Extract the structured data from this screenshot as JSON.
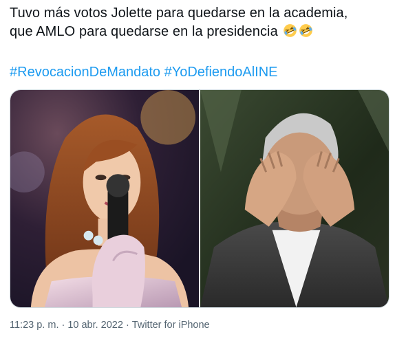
{
  "tweet": {
    "line1": "Tuvo más votos Jolette para quedarse en la academia,",
    "line2": "que AMLO para quedarse en la presidencia",
    "emoji_icon": "rolling-on-floor-laughing-emoji",
    "hashtags": [
      "#RevocacionDeMandato",
      "#YoDefiendoAlINE"
    ]
  },
  "media": {
    "photos": [
      {
        "icon": "photo-woman-singing-microphone"
      },
      {
        "icon": "photo-man-covering-eyes"
      }
    ]
  },
  "meta": {
    "time": "11:23 p. m.",
    "separator": "·",
    "date": "10 abr. 2022",
    "source": "Twitter for iPhone"
  },
  "colors": {
    "text": "#0f1419",
    "link": "#1d9bf0",
    "meta": "#536471",
    "border": "#cfd9de"
  }
}
